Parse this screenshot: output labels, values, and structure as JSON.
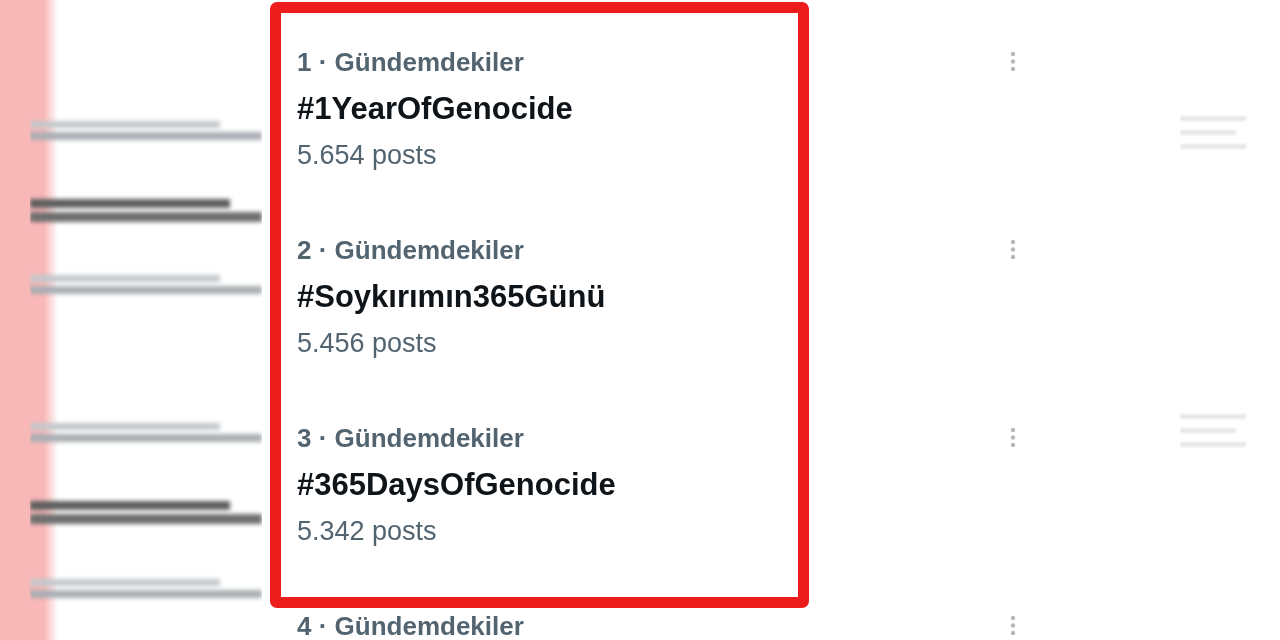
{
  "trends": [
    {
      "category": "1 · Gündemdekiler",
      "hashtag": "#1YearOfGenocide",
      "post_count": "5.654 posts"
    },
    {
      "category": "2 · Gündemdekiler",
      "hashtag": "#Soykırımın365Günü",
      "post_count": "5.456 posts"
    },
    {
      "category": "3 · Gündemdekiler",
      "hashtag": "#365DaysOfGenocide",
      "post_count": "5.342 posts"
    },
    {
      "category": "4 · Gündemdekiler"
    }
  ]
}
